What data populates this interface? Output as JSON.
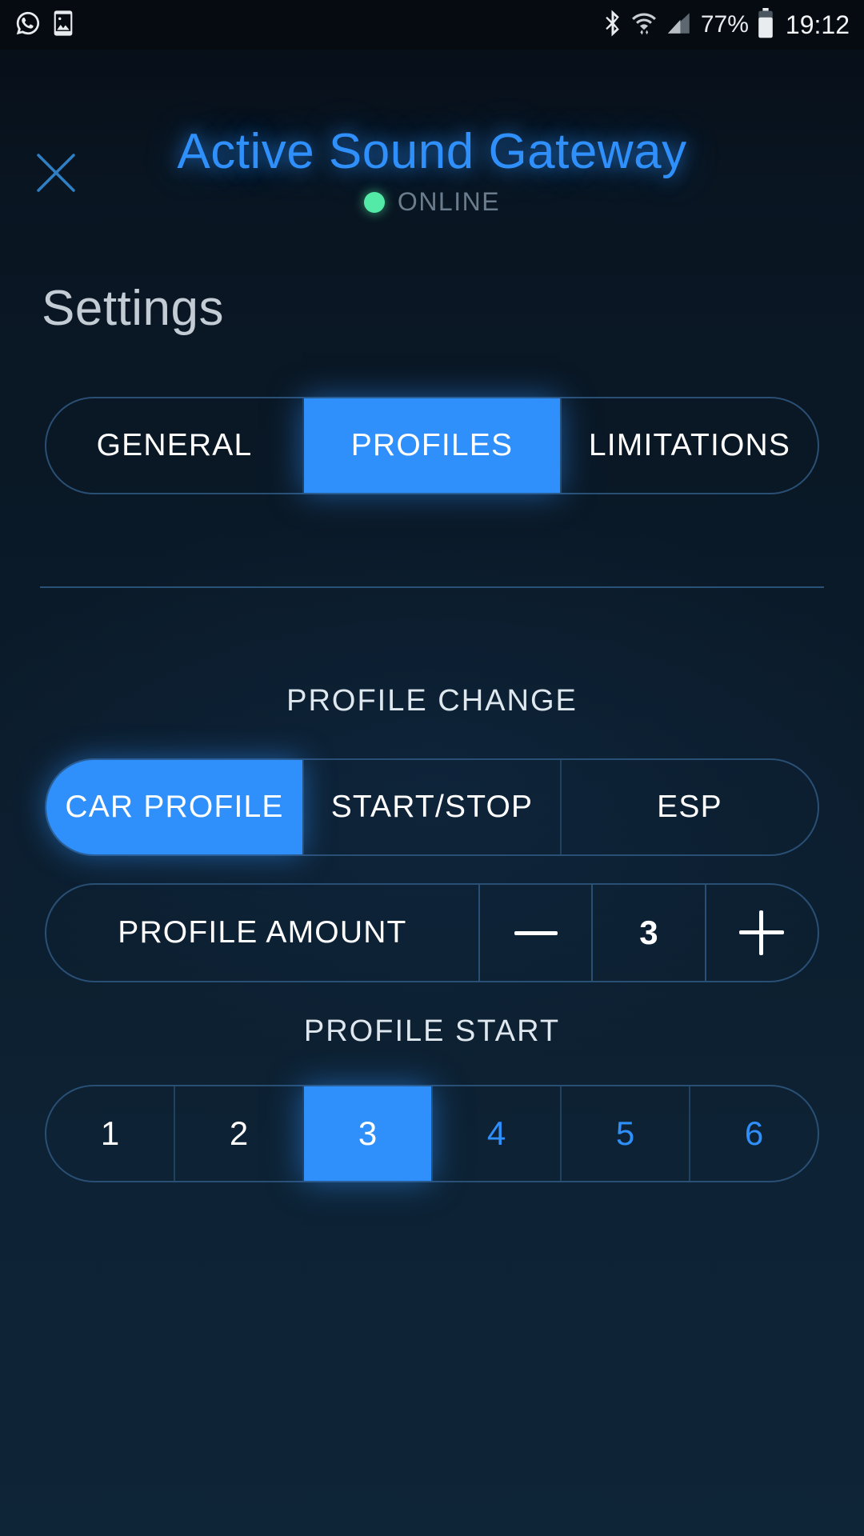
{
  "statusbar": {
    "left_icons": [
      "whatsapp-icon",
      "gallery-icon"
    ],
    "right_icons": [
      "bluetooth-icon",
      "wifi-icon",
      "cellular-signal-icon",
      "battery-icon"
    ],
    "battery_percent": "77%",
    "clock": "19:12"
  },
  "header": {
    "close_icon": "close-icon",
    "title": "Active Sound Gateway",
    "status": "ONLINE",
    "status_color": "#52eaa6",
    "title_color": "#2f8ffb"
  },
  "page": {
    "title": "Settings"
  },
  "tabs": {
    "items": [
      {
        "label": "GENERAL",
        "active": false
      },
      {
        "label": "PROFILES",
        "active": true
      },
      {
        "label": "LIMITATIONS",
        "active": false
      }
    ]
  },
  "profile_change": {
    "section_label": "PROFILE CHANGE",
    "items": [
      {
        "label": "CAR PROFILE",
        "active": true
      },
      {
        "label": "START/STOP",
        "active": false
      },
      {
        "label": "ESP",
        "active": false
      }
    ]
  },
  "profile_amount": {
    "label": "PROFILE AMOUNT",
    "decrement_icon": "minus-icon",
    "increment_icon": "plus-icon",
    "value": "3"
  },
  "profile_start": {
    "section_label": "PROFILE START",
    "items": [
      {
        "label": "1",
        "active": false,
        "dim": false
      },
      {
        "label": "2",
        "active": false,
        "dim": false
      },
      {
        "label": "3",
        "active": true,
        "dim": false
      },
      {
        "label": "4",
        "active": false,
        "dim": true
      },
      {
        "label": "5",
        "active": false,
        "dim": true
      },
      {
        "label": "6",
        "active": false,
        "dim": true
      }
    ]
  },
  "colors": {
    "accent": "#2f8ffb",
    "background": "#0b1b2a",
    "border": "#2a4f74",
    "online": "#52eaa6"
  }
}
